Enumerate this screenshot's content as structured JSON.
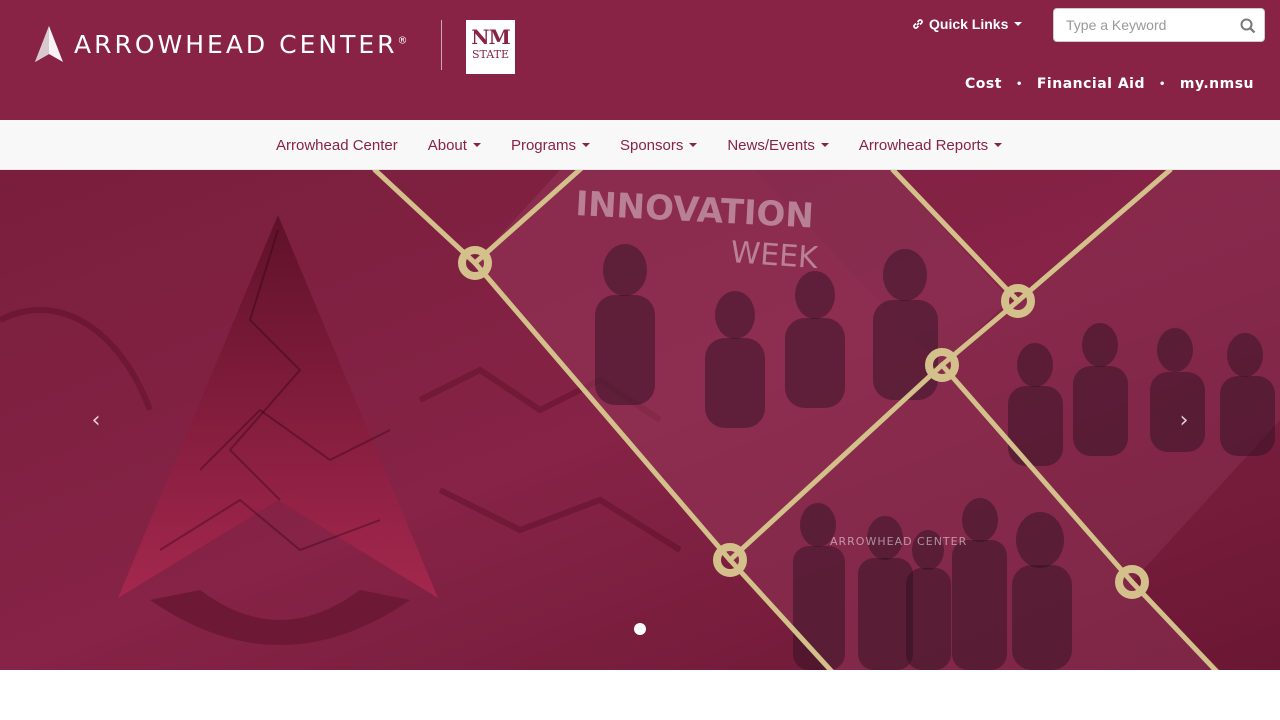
{
  "header": {
    "logo_text": "ARROWHEAD CENTER",
    "logo_reg": "®",
    "nm_logo_top": "NM",
    "nm_logo_bottom": "STATE",
    "quick_links_label": "Quick Links",
    "search_placeholder": "Type a Keyword",
    "util_links": [
      "Cost",
      "Financial Aid",
      "my.nmsu"
    ],
    "separator": "•"
  },
  "nav": {
    "items": [
      {
        "label": "Arrowhead Center",
        "dropdown": false
      },
      {
        "label": "About",
        "dropdown": true
      },
      {
        "label": "Programs",
        "dropdown": true
      },
      {
        "label": "Sponsors",
        "dropdown": true
      },
      {
        "label": "News/Events",
        "dropdown": true
      },
      {
        "label": "Arrowhead Reports",
        "dropdown": true
      }
    ]
  },
  "hero": {
    "prev_label": "‹",
    "next_label": "›",
    "photo_text_1": "INNOVATION",
    "photo_text_2": "WEEK",
    "photo_text_3": "ARROWHEAD CENTER",
    "active_slide": 1,
    "slide_count": 1
  },
  "colors": {
    "brand": "#882345",
    "accent_gold": "#d4c08a",
    "nav_bg": "#f8f8f8"
  }
}
